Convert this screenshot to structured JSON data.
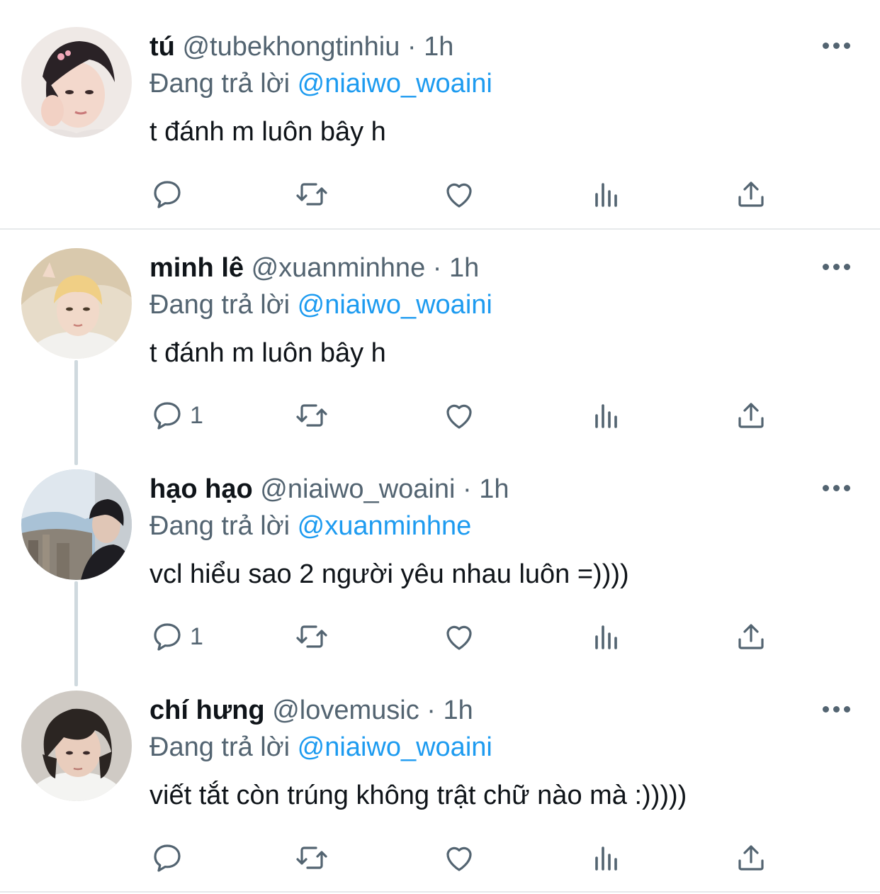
{
  "colors": {
    "accent": "#1d9bf0",
    "secondary_text": "#536471",
    "primary_text": "#0f1419",
    "divider": "#e7e9eb",
    "thread_line": "#cfd9de"
  },
  "tweets": [
    {
      "name": "tú",
      "handle": "@tubekhongtinhiu",
      "separator": "·",
      "time": "1h",
      "replying_prefix": "Đang trả lời",
      "replying_to": "@niaiwo_woaini",
      "text": "t đánh m luôn bây h",
      "reply_count": "",
      "icons": [
        "reply-icon",
        "retweet-icon",
        "like-icon",
        "views-icon",
        "share-icon",
        "more-icon"
      ]
    },
    {
      "name": "minh lê",
      "handle": "@xuanminhne",
      "separator": "·",
      "time": "1h",
      "replying_prefix": "Đang trả lời",
      "replying_to": "@niaiwo_woaini",
      "text": "t đánh m luôn bây h",
      "reply_count": "1",
      "icons": [
        "reply-icon",
        "retweet-icon",
        "like-icon",
        "views-icon",
        "share-icon",
        "more-icon"
      ]
    },
    {
      "name": "hạo hạo",
      "handle": "@niaiwo_woaini",
      "separator": "·",
      "time": "1h",
      "replying_prefix": "Đang trả lời",
      "replying_to": "@xuanminhne",
      "text": "vcl hiểu sao 2 người yêu nhau luôn =))))",
      "reply_count": "1",
      "icons": [
        "reply-icon",
        "retweet-icon",
        "like-icon",
        "views-icon",
        "share-icon",
        "more-icon"
      ]
    },
    {
      "name": "chí hưng",
      "handle": "@lovemusic",
      "separator": "·",
      "time": "1h",
      "replying_prefix": "Đang trả lời",
      "replying_to": "@niaiwo_woaini",
      "text": "viết tắt còn trúng không trật chữ nào mà :)))))",
      "reply_count": "",
      "icons": [
        "reply-icon",
        "retweet-icon",
        "like-icon",
        "views-icon",
        "share-icon",
        "more-icon"
      ]
    }
  ]
}
